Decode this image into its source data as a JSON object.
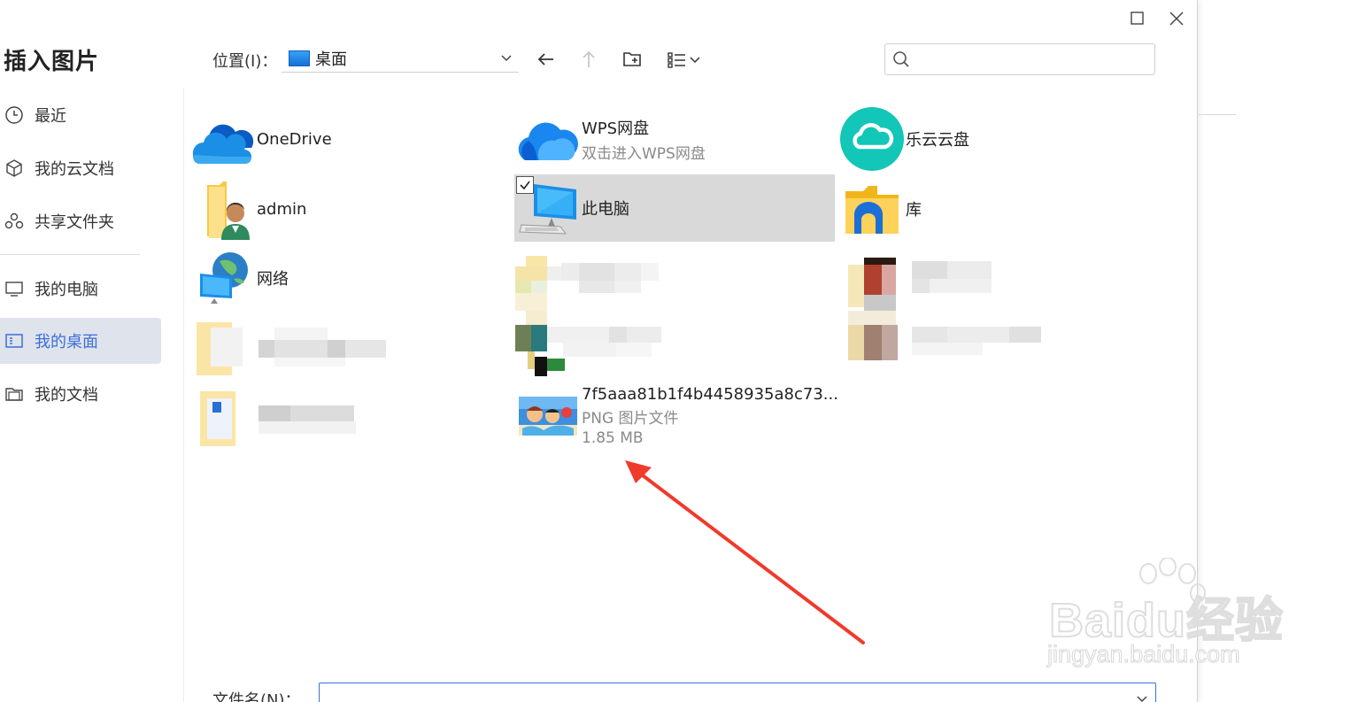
{
  "dialog": {
    "title": "插入图片"
  },
  "sidebar": {
    "items": [
      {
        "label": "最近",
        "icon": "clock-icon"
      },
      {
        "label": "我的云文档",
        "icon": "cube-icon"
      },
      {
        "label": "共享文件夹",
        "icon": "share-icon"
      },
      {
        "label": "我的电脑",
        "icon": "monitor-icon"
      },
      {
        "label": "我的桌面",
        "icon": "desktop-icon",
        "active": true
      },
      {
        "label": "我的文档",
        "icon": "folder-icon"
      }
    ]
  },
  "toolbar": {
    "location_label": "位置(I)：",
    "location_value": "桌面",
    "search_placeholder": ""
  },
  "files": [
    {
      "name": "OneDrive",
      "icon": "onedrive-icon"
    },
    {
      "name": "WPS网盘",
      "sub": "双击进入WPS网盘",
      "icon": "wps-cloud-icon"
    },
    {
      "name": "乐云云盘",
      "icon": "leyun-cloud-icon"
    },
    {
      "name": "admin",
      "icon": "user-folder-icon"
    },
    {
      "name": "此电脑",
      "icon": "computer-icon",
      "selected": true
    },
    {
      "name": "库",
      "icon": "library-folder-icon"
    },
    {
      "name": "网络",
      "icon": "network-icon"
    },
    {
      "name": "7f5aaa81b1f4b4458935a8c73...",
      "sub": "PNG 图片文件",
      "size": "1.85 MB",
      "icon": "image-thumbnail-icon"
    }
  ],
  "footer": {
    "filename_label": "文件名(N)：",
    "filename_value": ""
  },
  "watermark": {
    "main": "Baidu经验",
    "sub": "jingyan.baidu.com"
  },
  "colors": {
    "accent": "#3b6fd8",
    "selected_bg": "#d9d9d9",
    "sidebar_active_bg": "#dfe3ec",
    "arrow": "#f03a2c"
  }
}
